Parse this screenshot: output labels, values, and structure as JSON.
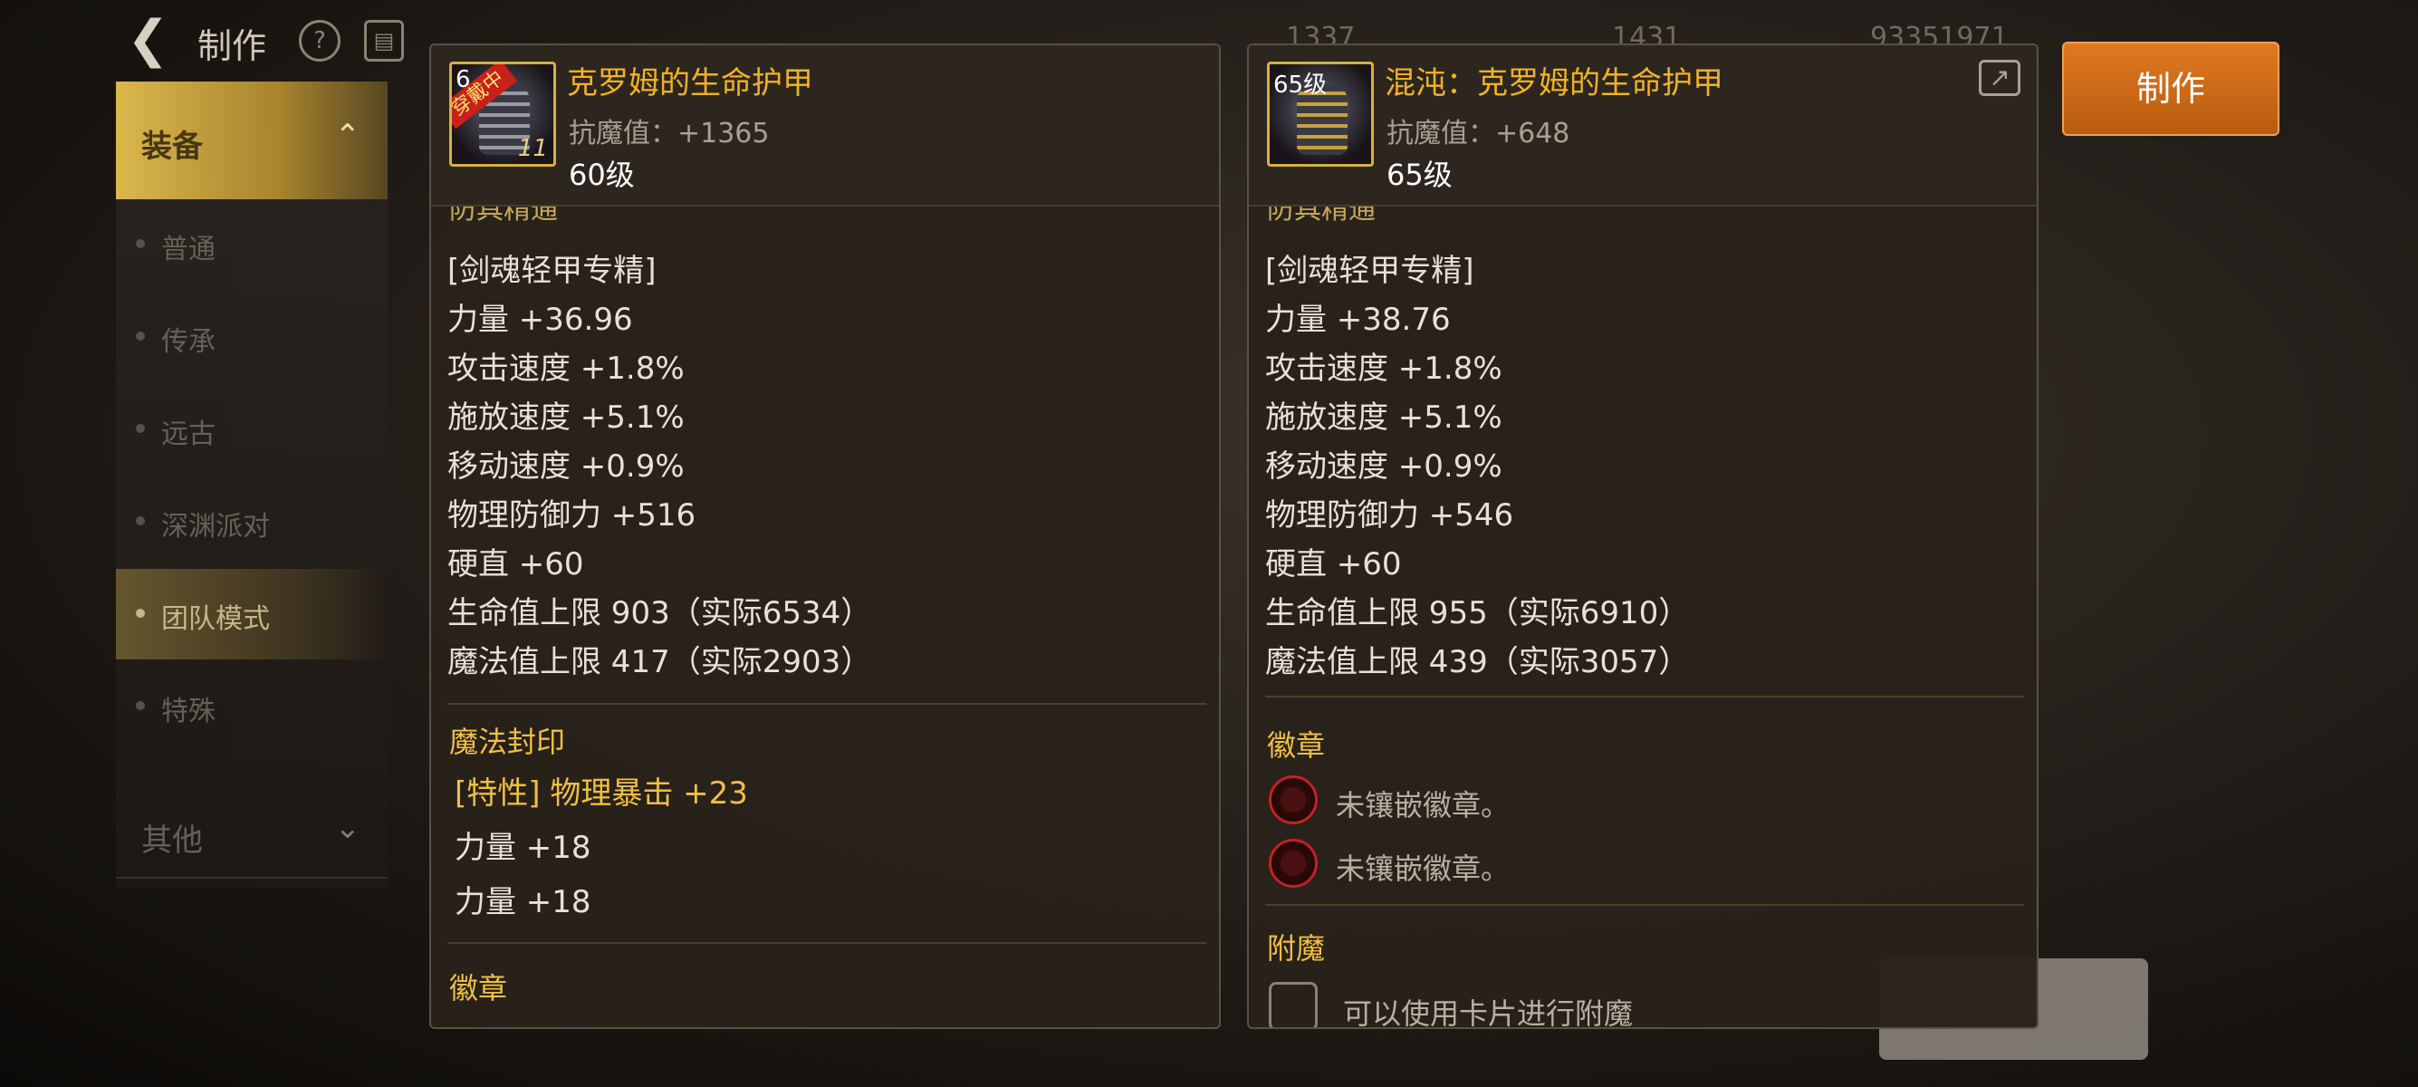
{
  "topbar": {
    "back_icon": "arrow-left-icon",
    "title": "制作",
    "currencies": [
      "1337",
      "1431",
      "93351971"
    ]
  },
  "sidebar": {
    "category": "装备",
    "items": [
      {
        "label": "普通",
        "selected": false
      },
      {
        "label": "传承",
        "selected": false
      },
      {
        "label": "远古",
        "selected": false
      },
      {
        "label": "深渊派对",
        "selected": false
      },
      {
        "label": "团队模式",
        "selected": true
      },
      {
        "label": "特殊",
        "selected": false
      }
    ],
    "other": "其他"
  },
  "craft_button": "制作",
  "left_item": {
    "name": "克罗姆的生命护甲",
    "icon_badge": "穿戴中",
    "icon_level": "6",
    "icon_num": "11",
    "anti_magic": "抗魔值：+1365",
    "level": "60级",
    "cut_heading": "防具精通",
    "stats": [
      "[剑魂轻甲专精]",
      "力量 +36.96",
      "攻击速度 +1.8%",
      "施放速度 +5.1%",
      "移动速度 +0.9%",
      "物理防御力 +516",
      "硬直 +60",
      "生命值上限 903（实际6534）",
      "魔法值上限 417（实际2903）"
    ],
    "seal_heading": "魔法封印",
    "seals": [
      "[特性] 物理暴击 +23",
      "力量 +18",
      "力量 +18"
    ],
    "emblem_heading": "徽章"
  },
  "right_item": {
    "name": "混沌：克罗姆的生命护甲",
    "icon_level": "65级",
    "anti_magic": "抗魔值：+648",
    "level": "65级",
    "cut_heading": "防具精通",
    "stats": [
      "[剑魂轻甲专精]",
      "力量 +38.76",
      "攻击速度 +1.8%",
      "施放速度 +5.1%",
      "移动速度 +0.9%",
      "物理防御力 +546",
      "硬直 +60",
      "生命值上限 955（实际6910）",
      "魔法值上限 439（实际3057）"
    ],
    "emblem_heading": "徽章",
    "emblems": [
      "未镶嵌徽章。",
      "未镶嵌徽章。"
    ],
    "enchant_heading": "附魔",
    "enchant_text": "可以使用卡片进行附魔"
  },
  "colors": {
    "accent_gold": "#f2b220",
    "craft_orange": "#d0701a",
    "emblem_red": "#c82020"
  }
}
